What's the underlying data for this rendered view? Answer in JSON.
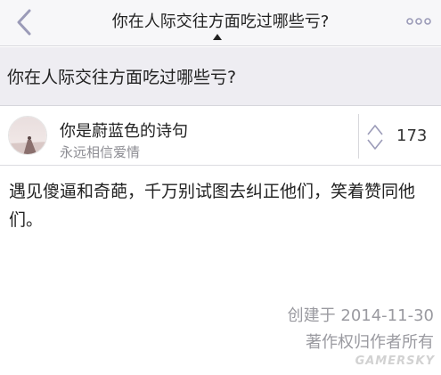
{
  "navbar": {
    "title": "你在人际交往方面吃过哪些亏?",
    "back_icon": "chevron-left-icon",
    "more_icon": "more-horizontal-icon",
    "accent_color": "#9b9bb8"
  },
  "question": {
    "title": "你在人际交往方面吃过哪些亏?"
  },
  "author": {
    "name": "你是蔚蓝色的诗句",
    "bio": "永远相信爱情"
  },
  "vote": {
    "count": "173"
  },
  "answer": {
    "text": "遇见傻逼和奇葩，千万别试图去纠正他们，笑着赞同他们。"
  },
  "meta": {
    "created": "创建于 2014-11-30",
    "copyright": "著作权归作者所有"
  },
  "watermark": {
    "text": "GAMERSKY"
  }
}
